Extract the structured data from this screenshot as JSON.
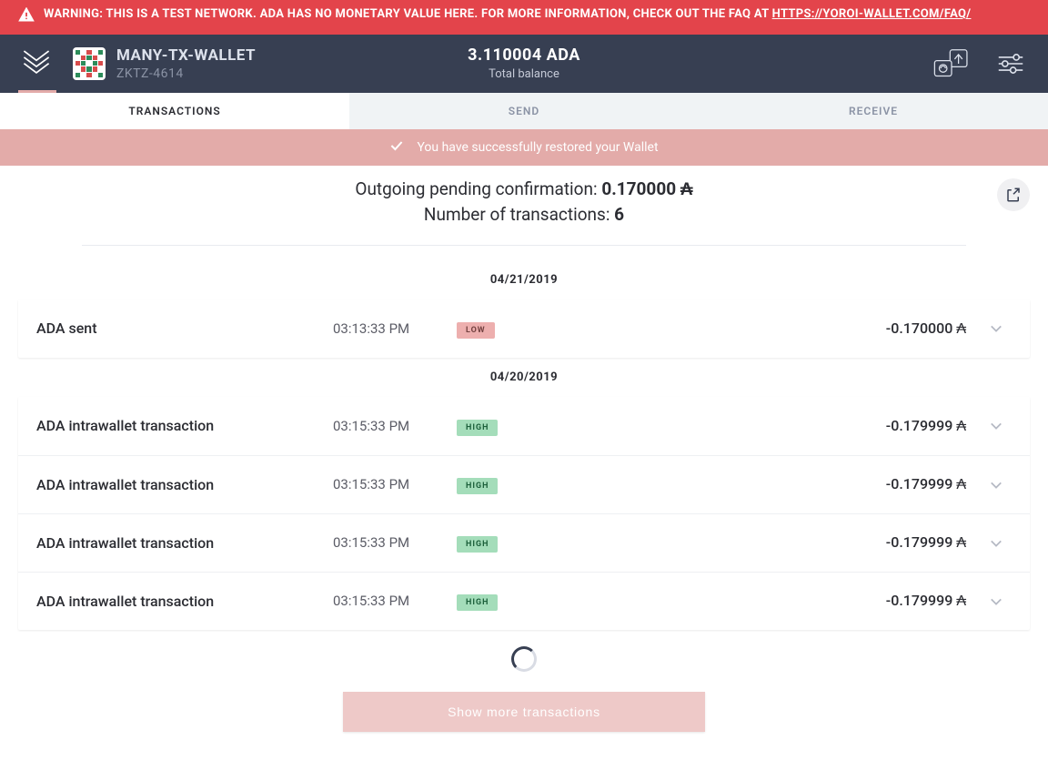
{
  "warning": {
    "text_a": "WARNING: THIS IS A TEST NETWORK. ADA HAS NO MONETARY VALUE HERE. FOR MORE INFORMATION, CHECK OUT THE FAQ AT ",
    "link": "HTTPS://YOROI-WALLET.COM/FAQ/"
  },
  "header": {
    "wallet_name": "MANY-TX-WALLET",
    "wallet_id": "ZKTZ-4614",
    "balance_amount": "3.110004 ADA",
    "balance_label": "Total balance"
  },
  "tabs": {
    "transactions": "TRANSACTIONS",
    "send": "SEND",
    "receive": "RECEIVE"
  },
  "success_msg": "You have successfully restored your Wallet",
  "summary": {
    "pending_label": "Outgoing pending confirmation: ",
    "pending_value": "0.170000",
    "count_label": "Number of transactions: ",
    "count_value": "6"
  },
  "dates": {
    "d1": "04/21/2019",
    "d2": "04/20/2019"
  },
  "tx": {
    "sent_title": "ADA sent",
    "intra_title": "ADA intrawallet transaction",
    "t1_time": "03:13:33 PM",
    "t1_assur": "LOW",
    "t1_amount": "-0.170000",
    "t2_time": "03:15:33 PM",
    "t2_assur": "HIGH",
    "t2_amount": "-0.179999",
    "t3_time": "03:15:33 PM",
    "t3_assur": "HIGH",
    "t3_amount": "-0.179999",
    "t4_time": "03:15:33 PM",
    "t4_assur": "HIGH",
    "t4_amount": "-0.179999",
    "t5_time": "03:15:33 PM",
    "t5_assur": "HIGH",
    "t5_amount": "-0.179999"
  },
  "show_more": "Show more transactions",
  "ada_symbol": "₳"
}
